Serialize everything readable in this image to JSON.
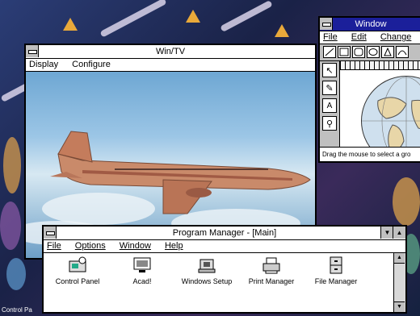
{
  "wintv": {
    "title": "Win/TV",
    "menu": [
      "Display",
      "Configure"
    ]
  },
  "paint": {
    "title": "Window",
    "menu": [
      "File",
      "Edit",
      "Change"
    ],
    "status": "Drag the mouse to select a gro"
  },
  "progman": {
    "title": "Program Manager - [Main]",
    "menu": [
      "File",
      "Options",
      "Window",
      "Help"
    ],
    "icons": [
      {
        "label": "Control Panel",
        "icon": "control-panel-icon"
      },
      {
        "label": "Acad!",
        "icon": "monitor-icon"
      },
      {
        "label": "Windows Setup",
        "icon": "setup-icon"
      },
      {
        "label": "Print Manager",
        "icon": "printer-icon"
      },
      {
        "label": "File Manager",
        "icon": "file-cabinet-icon"
      }
    ]
  },
  "taskbar_fragment": "Control Pa",
  "colors": {
    "active_title": "#1b1f9a",
    "chrome": "#c0c0c0",
    "sky": "#9cc6e6",
    "plane": "#c98a6a"
  }
}
